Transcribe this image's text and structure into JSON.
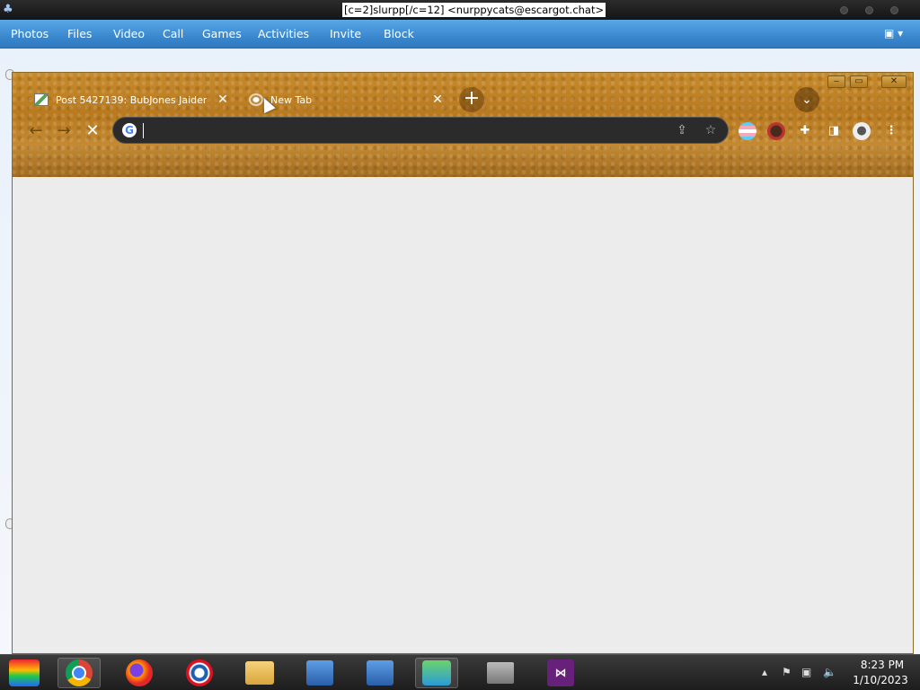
{
  "messenger": {
    "title": "[c=2]slurpp[/c=12] <nurppycats@escargot.chat>",
    "contact_name_partial": "[c=2]slurpp[/c=12]",
    "menu": [
      "Photos",
      "Files",
      "Video",
      "Call",
      "Games",
      "Activities",
      "Invite",
      "Block"
    ],
    "options_icon": "options-dropdown-icon"
  },
  "browser": {
    "window_controls": {
      "minimize": "‒",
      "maximize": "▭",
      "close": "✕"
    },
    "tabs": [
      {
        "label": "Post 5427139: BubJones Jaiden",
        "icon": "image-favicon",
        "active": false
      },
      {
        "label": "New Tab",
        "icon": "loading-favicon",
        "active": true
      }
    ],
    "new_tab_label": "+",
    "omnibox": {
      "value": "",
      "placeholder": ""
    },
    "extensions": [
      "pride-flag-extension",
      "avatar-extension",
      "puzzle-icon",
      "side-panel-icon",
      "profile-icon",
      "menu-icon"
    ]
  },
  "taskbar": {
    "apps": [
      "start",
      "chrome",
      "firefox",
      "opera",
      "file-explorer",
      "network-1",
      "network-2",
      "msn-messenger",
      "archive",
      "visual-studio"
    ],
    "active_app": "msn-messenger",
    "clock": {
      "time": "8:23 PM",
      "date": "1/10/2023"
    }
  }
}
